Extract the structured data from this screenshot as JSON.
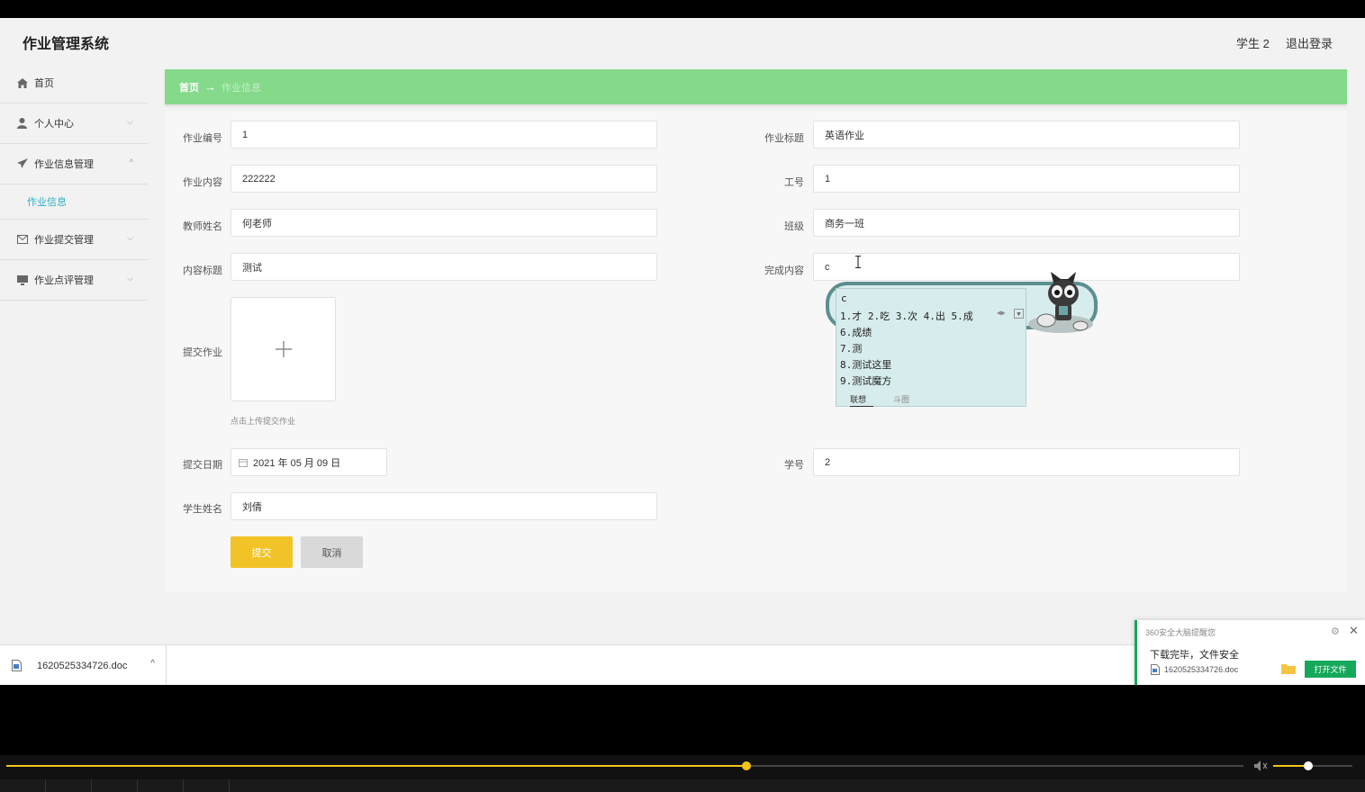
{
  "header": {
    "app_title": "作业管理系统",
    "user": "学生 2",
    "logout": "退出登录"
  },
  "sidebar": {
    "items": [
      {
        "label": "首页",
        "icon": "home-icon"
      },
      {
        "label": "个人中心",
        "icon": "user-icon"
      },
      {
        "label": "作业信息管理",
        "icon": "send-icon",
        "expanded": true,
        "sub": "作业信息"
      },
      {
        "label": "作业提交管理",
        "icon": "mail-icon"
      },
      {
        "label": "作业点评管理",
        "icon": "monitor-icon"
      }
    ]
  },
  "breadcrumb": {
    "home": "首页",
    "arrow": "→",
    "current": "作业信息"
  },
  "form": {
    "hw_no": {
      "label": "作业编号",
      "value": "1"
    },
    "hw_title": {
      "label": "作业标题",
      "value": "英语作业"
    },
    "hw_content": {
      "label": "作业内容",
      "value": "222222"
    },
    "staff_no": {
      "label": "工号",
      "value": "1"
    },
    "teacher": {
      "label": "教师姓名",
      "value": "何老师"
    },
    "class": {
      "label": "班级",
      "value": "商务一班"
    },
    "content_title": {
      "label": "内容标题",
      "value": "测试"
    },
    "done_content": {
      "label": "完成内容",
      "value": "c"
    },
    "upload": {
      "label": "提交作业",
      "hint": "点击上传提交作业"
    },
    "submit_date": {
      "label": "提交日期",
      "value": "2021 年 05 月 09 日"
    },
    "student_no": {
      "label": "学号",
      "value": "2"
    },
    "student_name": {
      "label": "学生姓名",
      "value": "刘倩"
    },
    "submit_btn": "提交",
    "cancel_btn": "取消"
  },
  "ime": {
    "input": "c",
    "row1": "1.才 2.吃 3.次 4.出 5.成",
    "cand6": "6.成绩",
    "cand7": "7.测",
    "cand8": "8.测试这里",
    "cand9": "9.测试魔方",
    "tab1": "联想",
    "tab2": "斗图"
  },
  "download_bar": {
    "filename": "1620525334726.doc"
  },
  "notification": {
    "title": "360安全大脑提醒您",
    "message": "下载完毕，文件安全",
    "file": "1620525334726.doc",
    "open_btn": "打开文件"
  },
  "player": {
    "progress": 0.598,
    "volume": 0.44
  },
  "colors": {
    "accent_green": "#84d98a",
    "submit_yellow": "#f2c327",
    "link_teal": "#2ab0c5",
    "notif_green": "#16a85a",
    "seek_yellow": "#f0c419"
  }
}
